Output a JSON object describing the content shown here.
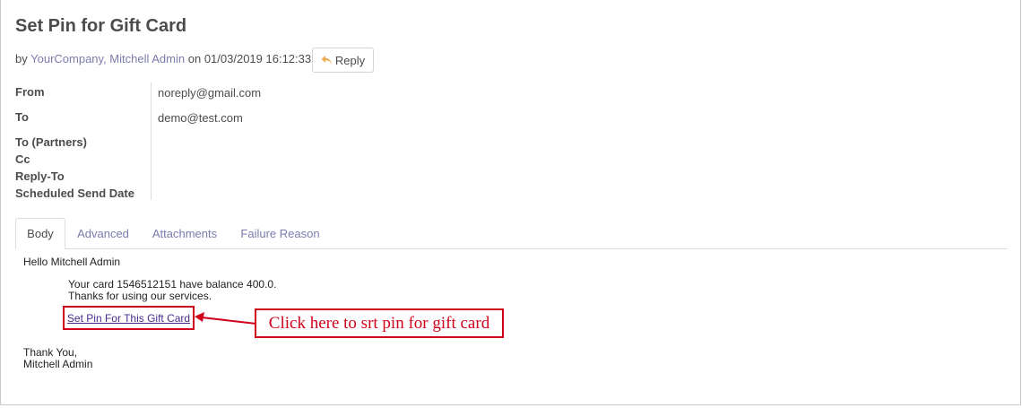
{
  "message": {
    "subject": "Set Pin for Gift Card",
    "by_prefix": "by",
    "author": "YourCompany, Mitchell Admin",
    "on_word": "on",
    "date": "01/03/2019 16:12:33",
    "reply_label": "Reply"
  },
  "fields": {
    "from_label": "From",
    "from_value": "noreply@gmail.com",
    "to_label": "To",
    "to_value": "demo@test.com",
    "to_partners_label": "To (Partners)",
    "cc_label": "Cc",
    "reply_to_label": "Reply-To",
    "scheduled_label": "Scheduled Send Date"
  },
  "tabs": [
    {
      "label": "Body",
      "active": true
    },
    {
      "label": "Advanced",
      "active": false
    },
    {
      "label": "Attachments",
      "active": false
    },
    {
      "label": "Failure Reason",
      "active": false
    }
  ],
  "body": {
    "greeting": "Hello Mitchell Admin",
    "line1": "Your card 1546512151 have balance 400.0.",
    "line2": "Thanks for using our services.",
    "link_text": "Set Pin For This Gift Card",
    "closing1": "Thank You,",
    "closing2": "Mitchell Admin"
  },
  "annotation": {
    "text": "Click here to srt pin for gift card",
    "color": "#d0021b"
  },
  "colors": {
    "link": "#7c7bad",
    "reply_icon": "#f0ad4e",
    "border": "#dddddd"
  },
  "icons": {
    "reply": "reply-arrow-icon"
  }
}
